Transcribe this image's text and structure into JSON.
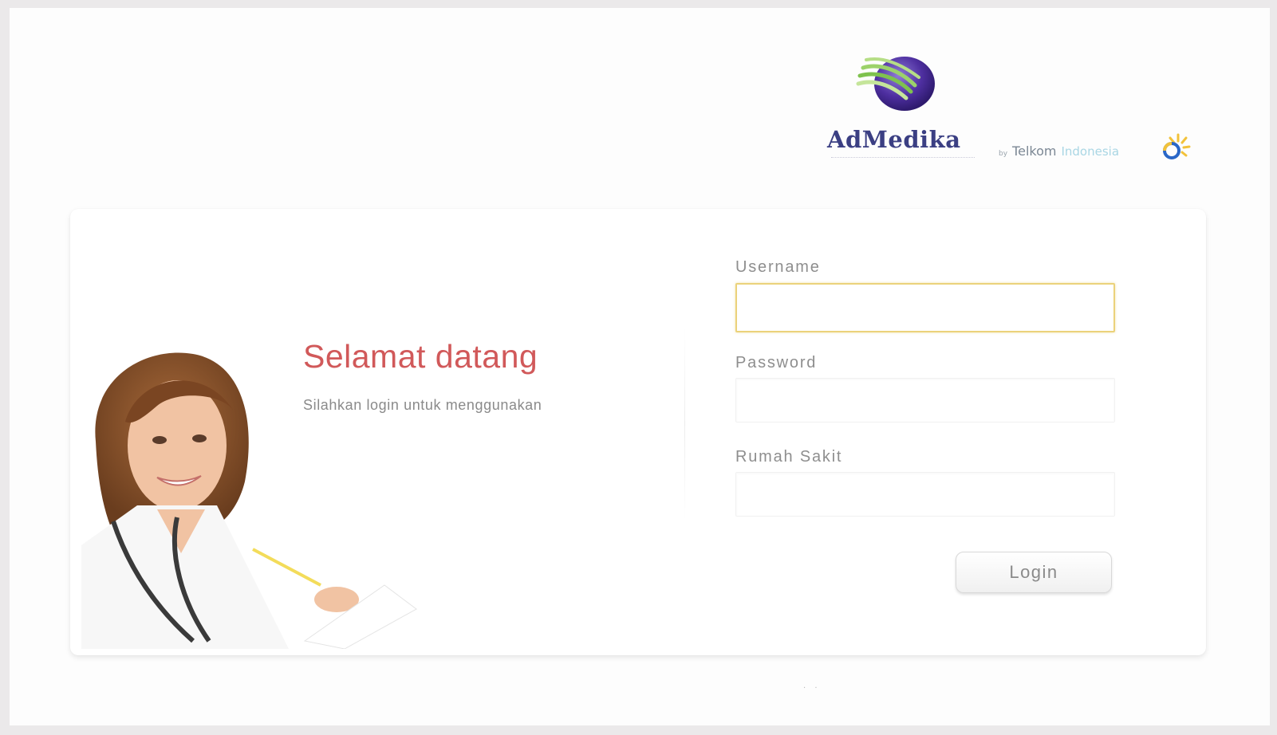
{
  "header": {
    "brand_name": "AdMedika",
    "partner_by": "by",
    "partner_telkom": "Telkom",
    "partner_indonesia": "Indonesia",
    "logo_icon": "globe-logo-icon",
    "partner_icon": "telkom-sun-icon"
  },
  "welcome": {
    "title": "Selamat datang",
    "subtitle": "Silahkan login untuk menggunakan"
  },
  "form": {
    "username_label": "Username",
    "username_value": "",
    "password_label": "Password",
    "password_value": "",
    "hospital_label": "Rumah Sakit",
    "hospital_value": "",
    "login_label": "Login"
  },
  "footer": {
    "dots": ". ."
  },
  "colors": {
    "title": "#d1595a",
    "brand": "#3b3f83",
    "focus_border": "#ebd27b",
    "text_muted": "#8e8e8e"
  }
}
